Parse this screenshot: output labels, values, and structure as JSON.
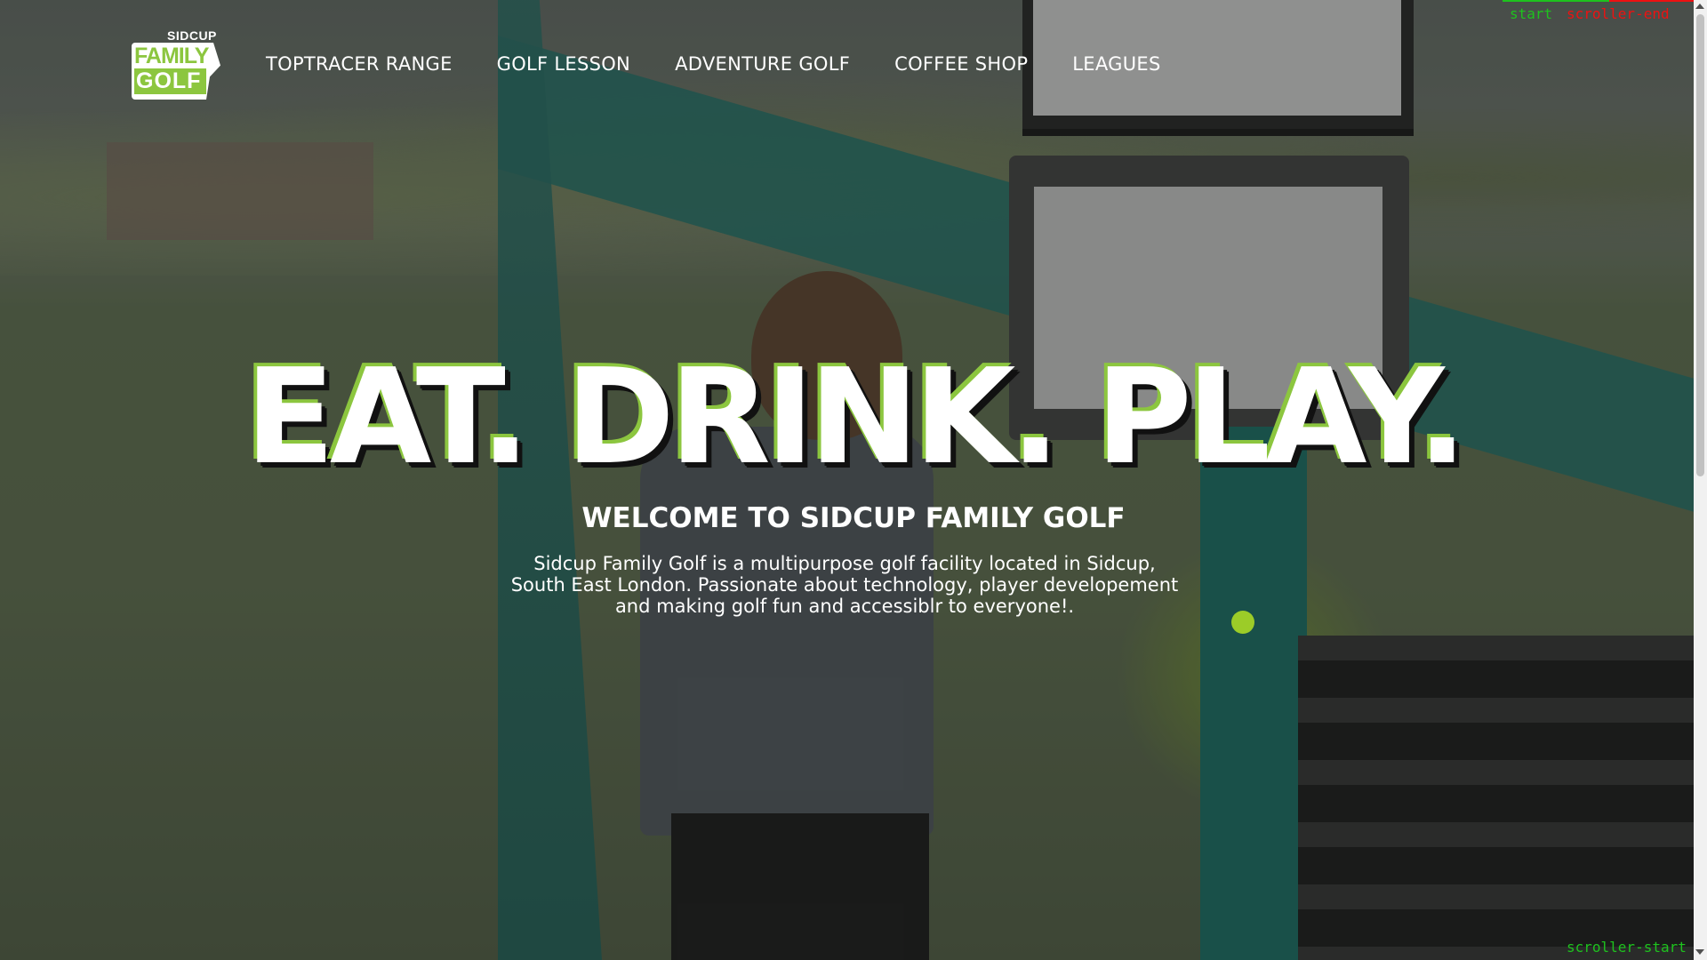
{
  "header": {
    "logo": {
      "small_text": "SIDCUP",
      "line1": "FAMILY",
      "line2": "GOLF"
    },
    "nav": [
      {
        "label": "TOPTRACER RANGE"
      },
      {
        "label": "GOLF LESSON"
      },
      {
        "label": "ADVENTURE GOLF"
      },
      {
        "label": "COFFEE SHOP"
      },
      {
        "label": "LEAGUES"
      }
    ]
  },
  "hero": {
    "title": "EAT. DRINK. PLAY.",
    "subtitle": "WELCOME TO SIDCUP FAMILY GOLF",
    "description": "Sidcup Family Golf is a multipurpose golf facility located in Sidcup, South East London. Passionate about technology, player developement and making golf fun and accessiblr to everyone!."
  },
  "debug": {
    "start": "start",
    "scroller_end": "scroller-end",
    "scroller_start": "scroller-start"
  },
  "colors": {
    "brand_green": "#8cc63f",
    "dot_green": "#9ccc28"
  }
}
